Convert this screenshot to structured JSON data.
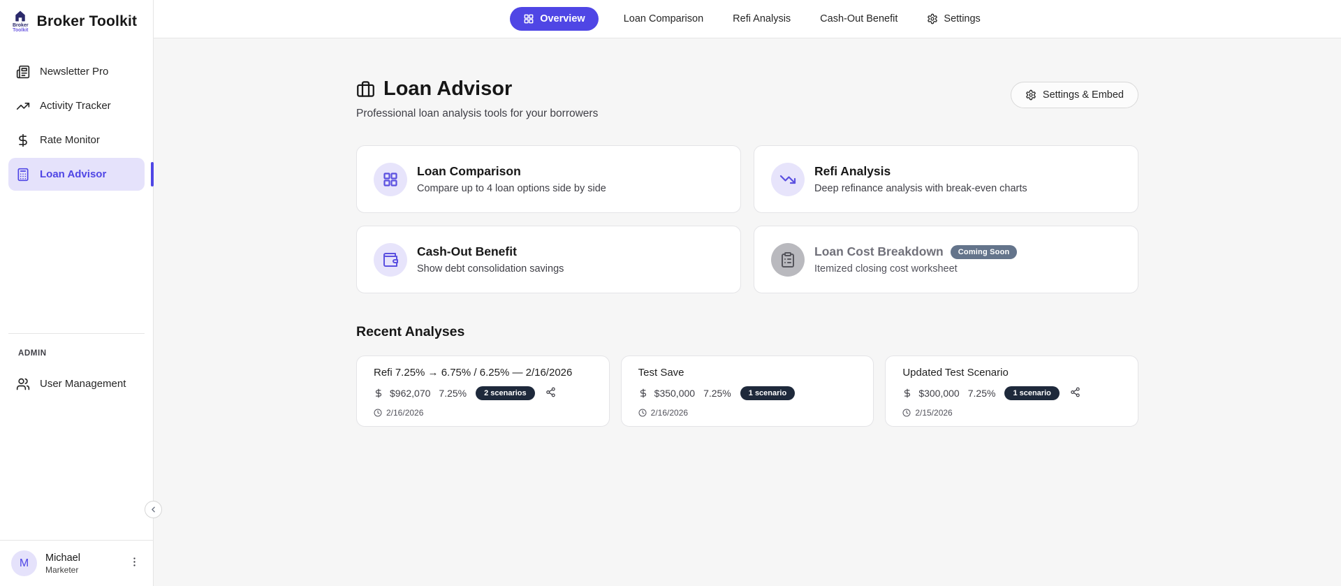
{
  "app": {
    "brand": "Broker Toolkit",
    "logo_line1": "Broker",
    "logo_line2": "Toolkit"
  },
  "top_nav": {
    "items": [
      {
        "label": "Overview",
        "icon": "grid-icon",
        "active": true
      },
      {
        "label": "Loan Comparison",
        "active": false
      },
      {
        "label": "Refi Analysis",
        "active": false
      },
      {
        "label": "Cash-Out Benefit",
        "active": false
      },
      {
        "label": "Settings",
        "icon": "gear-icon",
        "active": false
      }
    ]
  },
  "sidebar": {
    "items": [
      {
        "label": "Newsletter Pro",
        "icon": "newspaper-icon",
        "active": false
      },
      {
        "label": "Activity Tracker",
        "icon": "trending-up-icon",
        "active": false
      },
      {
        "label": "Rate Monitor",
        "icon": "dollar-icon",
        "active": false
      },
      {
        "label": "Loan Advisor",
        "icon": "calculator-icon",
        "active": true
      }
    ],
    "admin_section_label": "ADMIN",
    "admin_items": [
      {
        "label": "User Management",
        "icon": "users-icon"
      }
    ],
    "user": {
      "initial": "M",
      "name": "Michael",
      "role": "Marketer"
    }
  },
  "page": {
    "title": "Loan Advisor",
    "subtitle": "Professional loan analysis tools for your borrowers",
    "settings_embed_label": "Settings & Embed"
  },
  "feature_cards": [
    {
      "title": "Loan Comparison",
      "description": "Compare up to 4 loan options side by side",
      "icon": "grid-icon",
      "disabled": false
    },
    {
      "title": "Refi Analysis",
      "description": "Deep refinance analysis with break-even charts",
      "icon": "trending-down-icon",
      "disabled": false
    },
    {
      "title": "Cash-Out Benefit",
      "description": "Show debt consolidation savings",
      "icon": "wallet-icon",
      "disabled": false
    },
    {
      "title": "Loan Cost Breakdown",
      "description": "Itemized closing cost worksheet",
      "icon": "clipboard-icon",
      "badge": "Coming Soon",
      "disabled": true
    }
  ],
  "recent": {
    "heading": "Recent Analyses",
    "analyses": [
      {
        "title": "Refi 7.25% → 6.75% / 6.25% — 2/16/2026",
        "amount": "$962,070",
        "rate": "7.25%",
        "badge": "2 scenarios",
        "date": "2/16/2026",
        "shared": true
      },
      {
        "title": "Test Save",
        "amount": "$350,000",
        "rate": "7.25%",
        "badge": "1 scenario",
        "date": "2/16/2026",
        "shared": false
      },
      {
        "title": "Updated Test Scenario",
        "amount": "$300,000",
        "rate": "7.25%",
        "badge": "1 scenario",
        "date": "2/15/2026",
        "shared": true
      }
    ]
  },
  "colors": {
    "primary": "#4f46e5",
    "primary_light_bg": "#e5e2fb",
    "scenario_badge": "#1e293b",
    "coming_soon_badge": "#64748b",
    "page_background": "#f6f6f6"
  }
}
